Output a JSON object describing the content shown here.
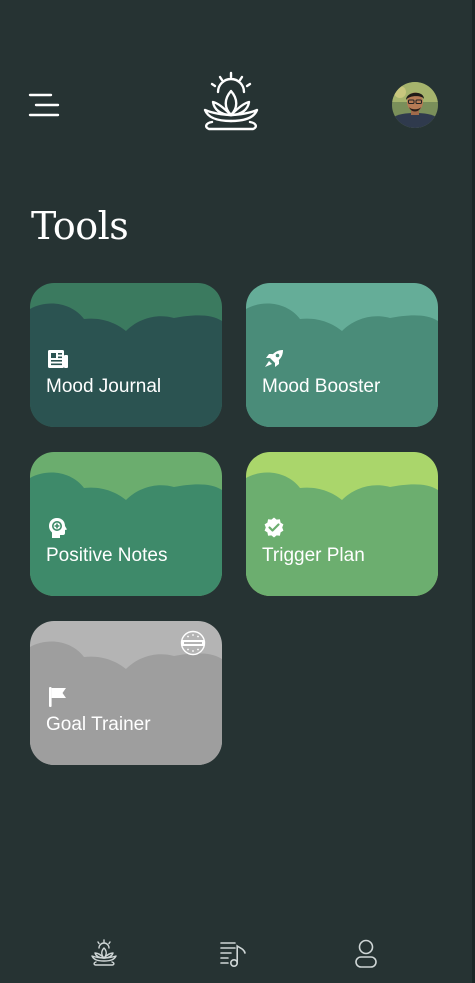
{
  "page": {
    "title": "Tools"
  },
  "header": {
    "menu_icon": "hamburger-menu-icon",
    "logo_icon": "lotus-sun-logo",
    "avatar_icon": "user-avatar"
  },
  "tools": [
    {
      "label": "Mood Journal",
      "icon": "newspaper-icon",
      "colors": {
        "top": "#3b7a5f",
        "bottom": "#2b5351"
      },
      "locked": false
    },
    {
      "label": "Mood Booster",
      "icon": "rocket-icon",
      "colors": {
        "top": "#65ad98",
        "bottom": "#4a8c79"
      },
      "locked": false
    },
    {
      "label": "Positive Notes",
      "icon": "head-plus-icon",
      "colors": {
        "top": "#6bad6e",
        "bottom": "#3e8a6a"
      },
      "locked": false
    },
    {
      "label": "Trigger Plan",
      "icon": "verified-badge-icon",
      "colors": {
        "top": "#aad66b",
        "bottom": "#6cae6f"
      },
      "locked": false
    },
    {
      "label": "Goal Trainer",
      "icon": "flag-icon",
      "colors": {
        "top": "#b4b4b4",
        "bottom": "#9e9e9e"
      },
      "locked": true,
      "badge_icon": "premium-badge-icon"
    }
  ],
  "bottom_nav": [
    {
      "name": "home",
      "icon": "lotus-icon"
    },
    {
      "name": "playlist",
      "icon": "music-list-icon"
    },
    {
      "name": "profile",
      "icon": "person-icon"
    }
  ]
}
